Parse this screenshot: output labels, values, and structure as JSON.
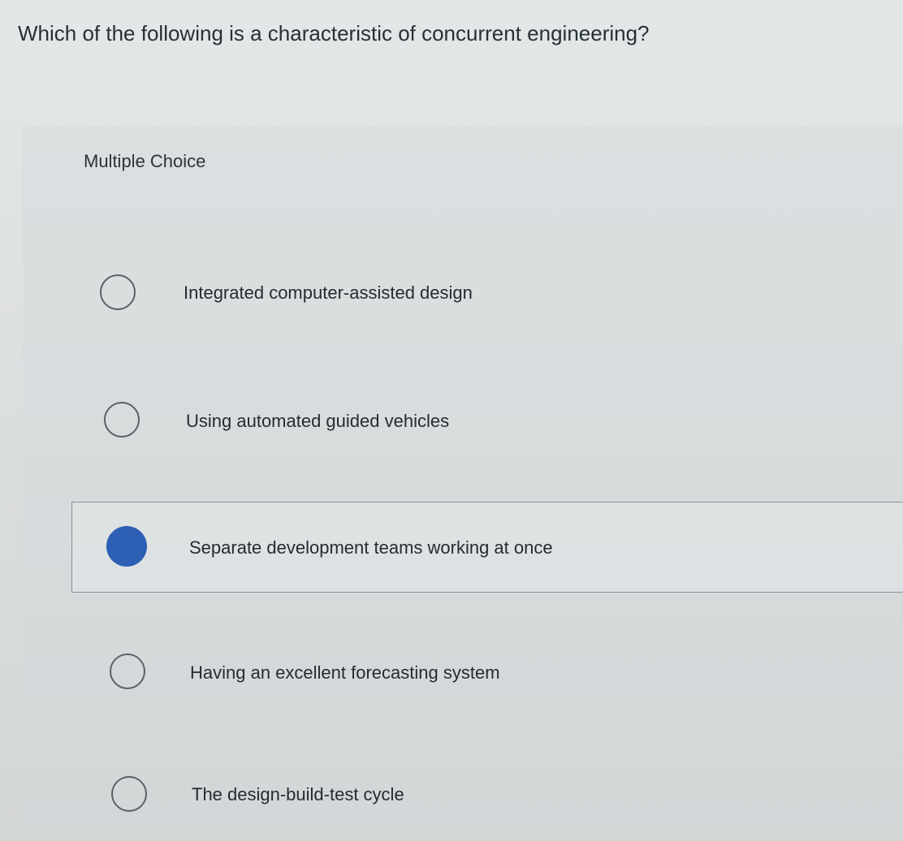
{
  "question": {
    "text": "Which of the following is a characteristic of concurrent engineering?"
  },
  "choice_type": "Multiple Choice",
  "options": [
    {
      "label": "Integrated computer-assisted design",
      "selected": false
    },
    {
      "label": "Using automated guided vehicles",
      "selected": false
    },
    {
      "label": "Separate development teams working at once",
      "selected": true
    },
    {
      "label": "Having an excellent forecasting system",
      "selected": false
    },
    {
      "label": "The design-build-test cycle",
      "selected": false
    }
  ],
  "colors": {
    "selected_radio": "#2d5fb4",
    "radio_border": "#5a6266",
    "text": "#252c30"
  },
  "icons": {
    "unselected": "radio-unselected-icon",
    "selected": "radio-selected-icon"
  }
}
